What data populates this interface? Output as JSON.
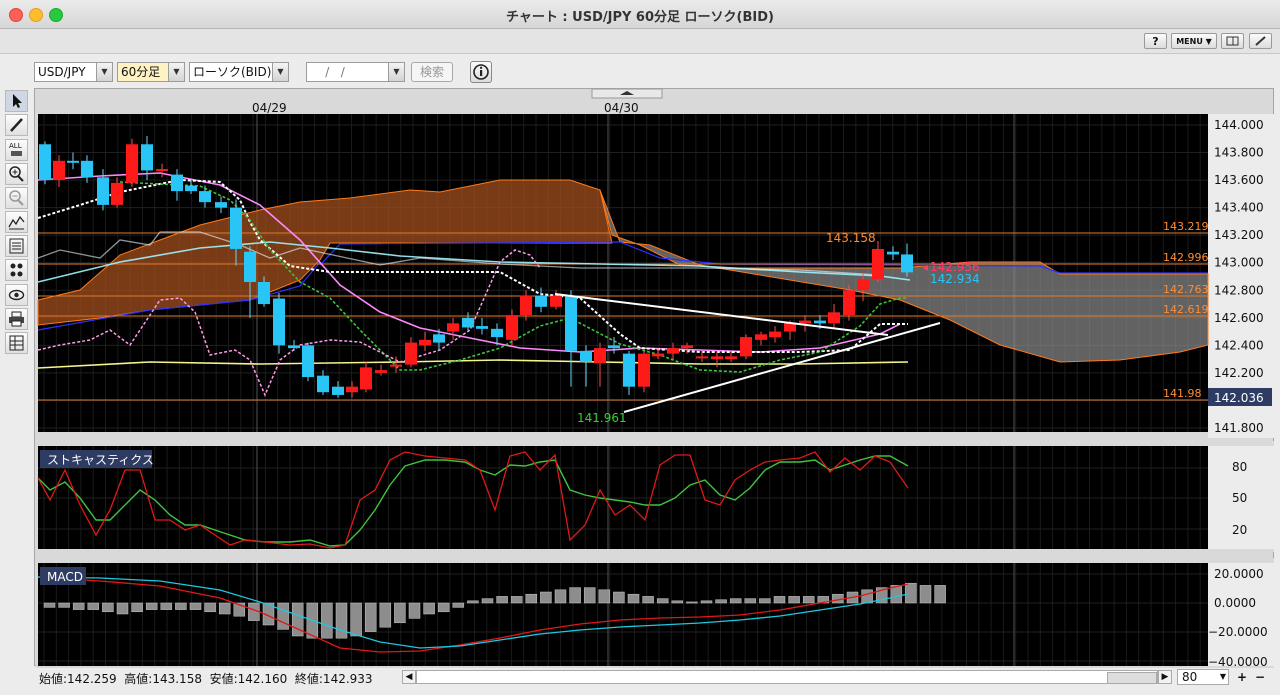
{
  "window": {
    "title": "チャート : USD/JPY 60分足 ローソク(BID)"
  },
  "menubar": {
    "help_label": "?",
    "menu_label": "MENU ▼"
  },
  "toolbar": {
    "pair": "USD/JPY",
    "timeframe": "60分足",
    "chart_type": "ローソク(BID)",
    "date_placeholder": "    /   /   ",
    "search_label": "検索"
  },
  "chart": {
    "date_labels": [
      "04/29",
      "04/30"
    ],
    "price_ticks": [
      "144.000",
      "143.800",
      "143.600",
      "143.400",
      "143.200",
      "143.000",
      "142.800",
      "142.600",
      "142.400",
      "142.200",
      "142.000",
      "141.800"
    ],
    "current_price": "142.036",
    "annotations": {
      "high": "143.158",
      "low": "141.961",
      "bid_red": "142.956",
      "bid_blue": "142.934"
    },
    "level_labels": [
      "143.219",
      "142.996",
      "142.763",
      "142.619",
      "141.98"
    ],
    "colors": {
      "bg": "#000000",
      "up": "#ff1a1a",
      "down": "#29c5f6",
      "cloud_up": "#a0522d",
      "cloud_down": "#808080"
    }
  },
  "stochastic": {
    "title": "ストキャスティクス",
    "ticks": [
      "80",
      "50",
      "20"
    ]
  },
  "macd": {
    "title": "MACD",
    "ticks": [
      "20.0000",
      "0.0000",
      "−20.0000",
      "−40.0000"
    ]
  },
  "status": {
    "text": "始値:142.259  高値:143.158  安値:142.160  終値:142.933",
    "zoom": "80"
  }
}
